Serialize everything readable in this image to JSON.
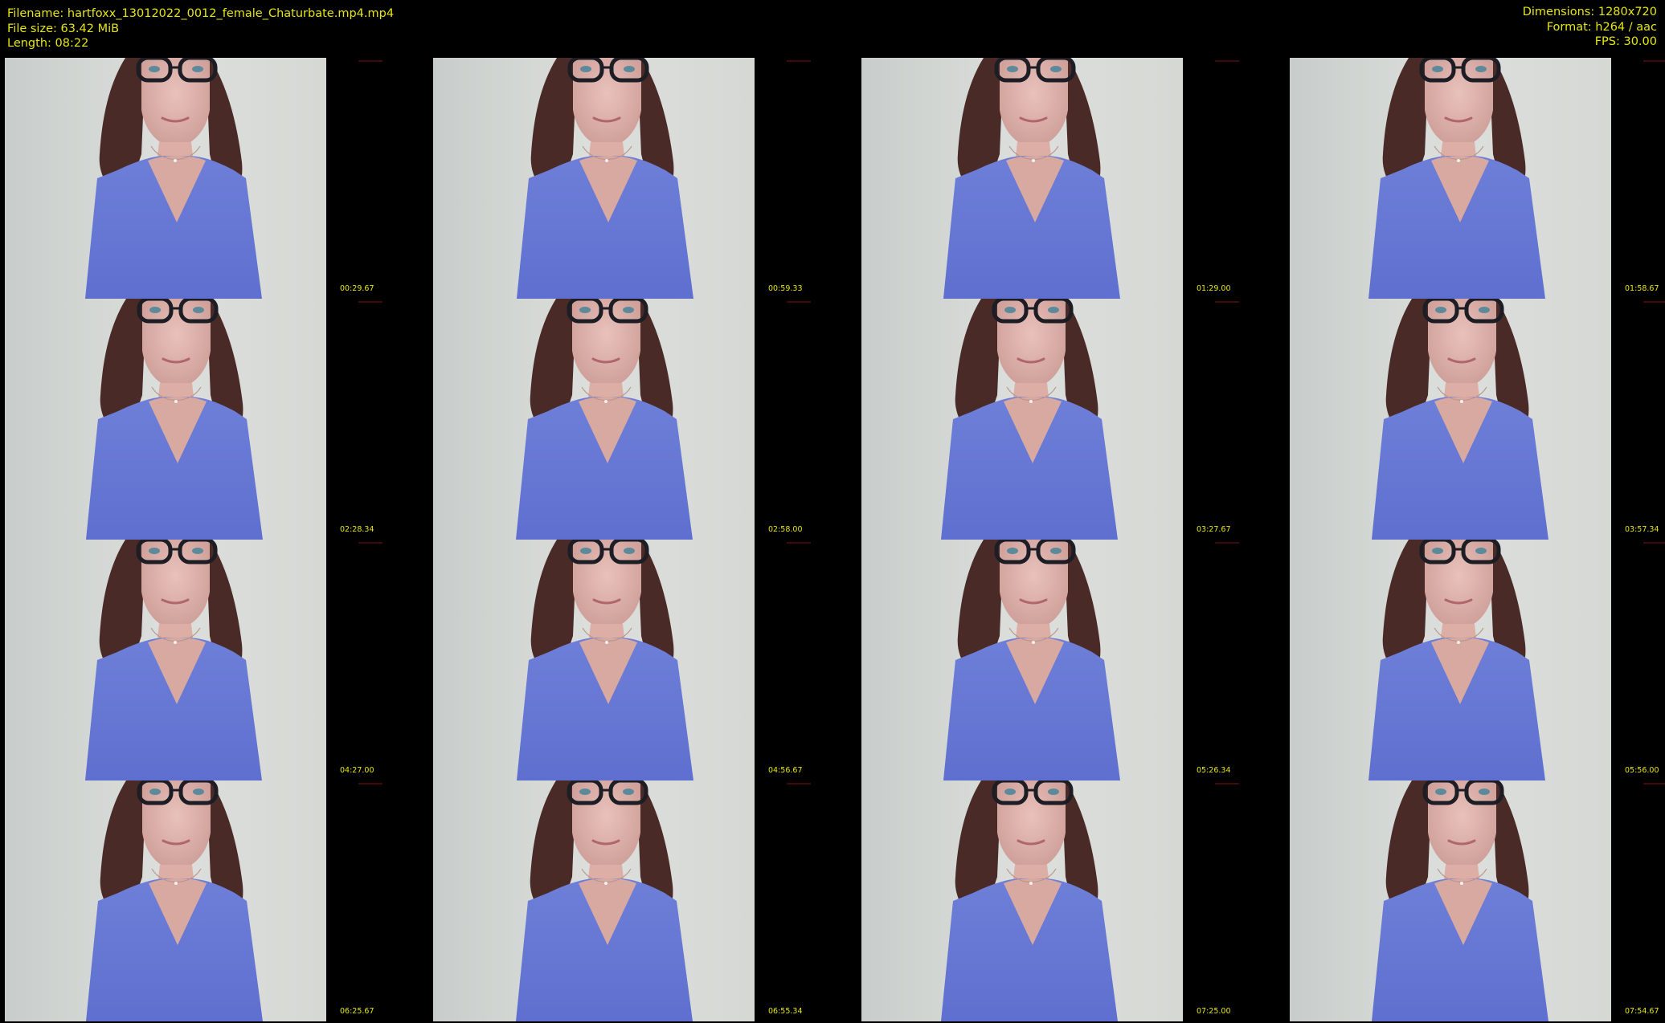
{
  "header": {
    "filename": "Filename: hartfoxx_13012022_0012_female_Chaturbate.mp4.mp4",
    "file_size": "File size: 63.42 MiB",
    "length": "Length: 08:22",
    "dimensions": "Dimensions: 1280x720",
    "format": "Format: h264 / aac",
    "fps": "FPS: 30.00"
  },
  "colors": {
    "text": "#e6e60f",
    "background": "#000000"
  },
  "thumbnails": [
    {
      "timestamp": "00:29.67"
    },
    {
      "timestamp": "00:59.33"
    },
    {
      "timestamp": "01:29.00"
    },
    {
      "timestamp": "01:58.67"
    },
    {
      "timestamp": "02:28.34"
    },
    {
      "timestamp": "02:58.00"
    },
    {
      "timestamp": "03:27.67"
    },
    {
      "timestamp": "03:57.34"
    },
    {
      "timestamp": "04:27.00"
    },
    {
      "timestamp": "04:56.67"
    },
    {
      "timestamp": "05:26.34"
    },
    {
      "timestamp": "05:56.00"
    },
    {
      "timestamp": "06:25.67"
    },
    {
      "timestamp": "06:55.34"
    },
    {
      "timestamp": "07:25.00"
    },
    {
      "timestamp": "07:54.67"
    }
  ]
}
